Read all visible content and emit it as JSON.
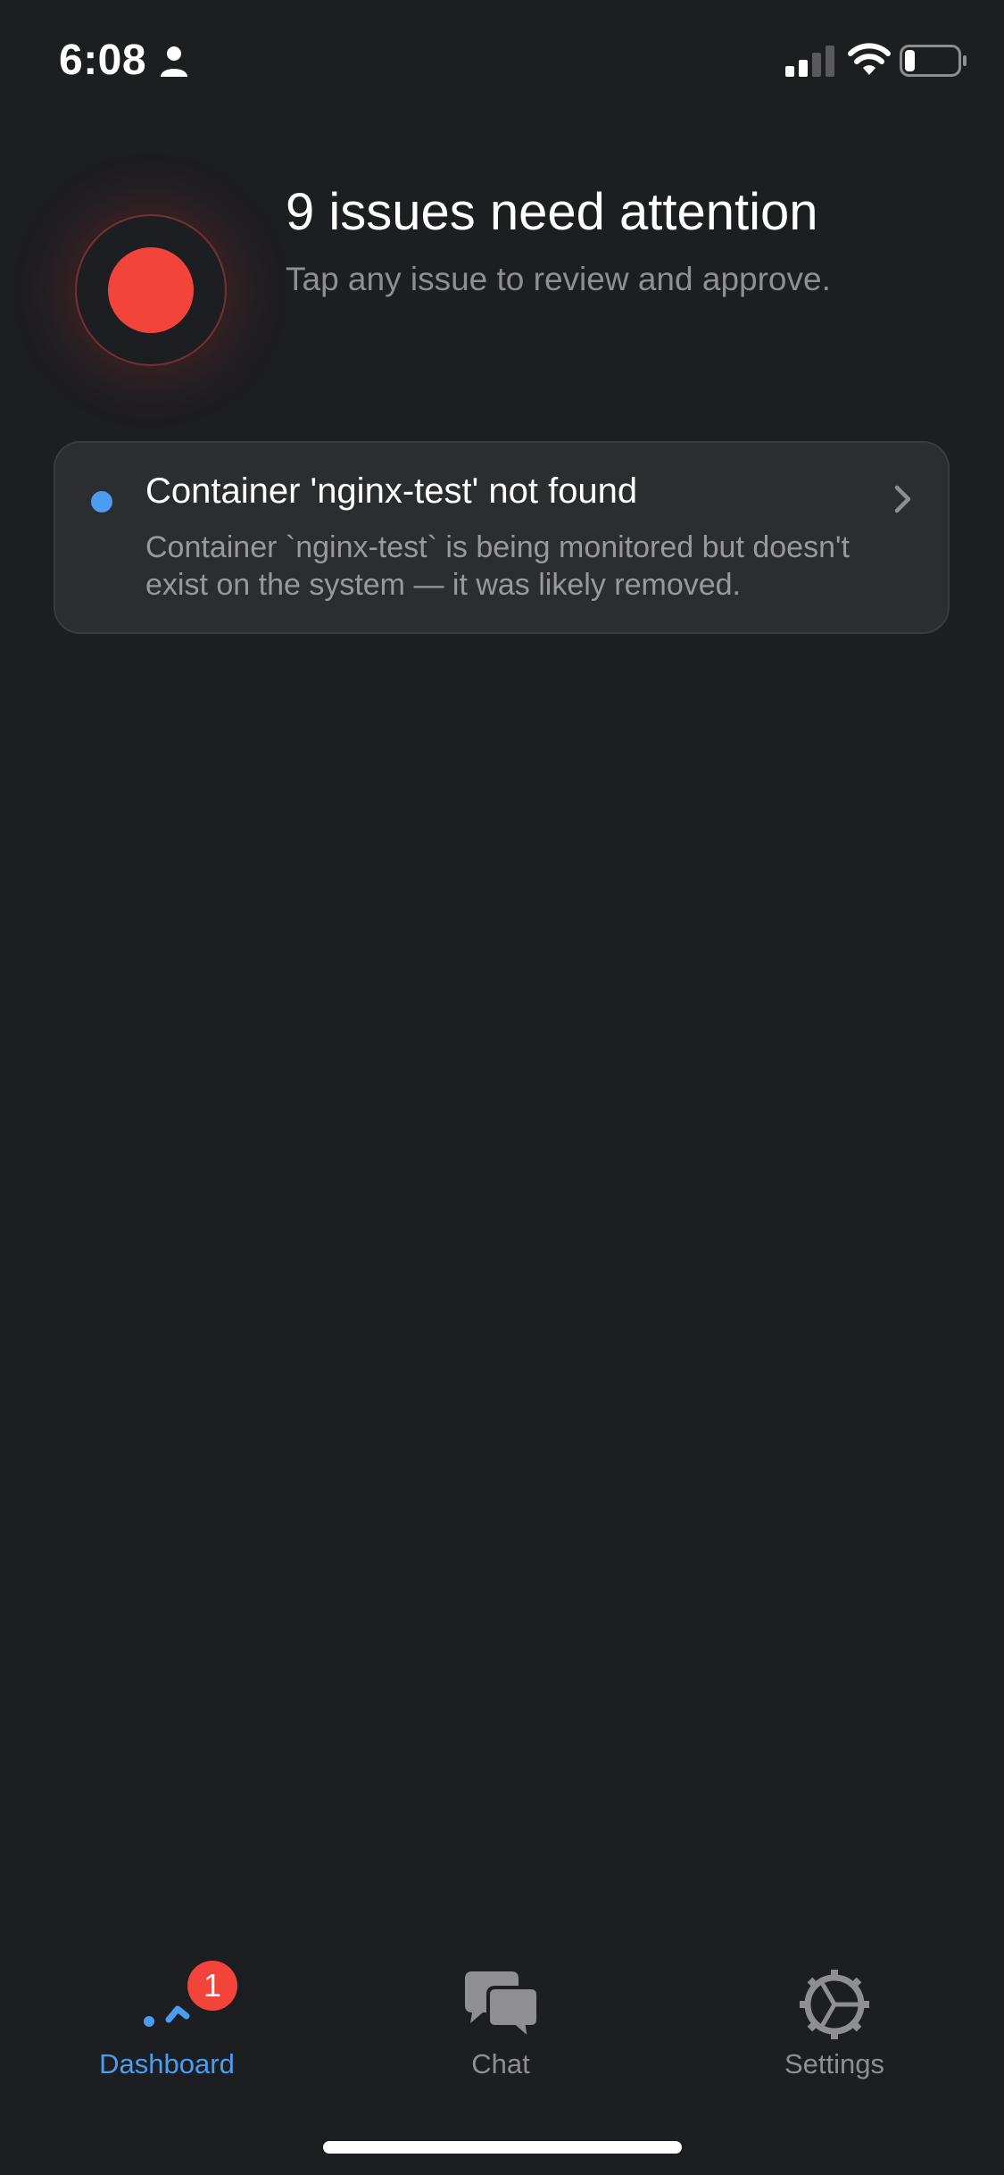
{
  "status_bar": {
    "time": "6:08",
    "icons": [
      "person-icon",
      "signal-icon",
      "wifi-icon",
      "battery-icon"
    ],
    "battery_level": 0.2
  },
  "header": {
    "title": "9 issues need attention",
    "subtitle": "Tap any issue to review and approve.",
    "indicator_color": "#f2443a"
  },
  "issues": [
    {
      "title": "Container 'nginx-test' not found",
      "description": "Container `nginx-test` is being monitored but doesn't exist on the system — it was likely removed.",
      "status_color": "#4a9df0"
    }
  ],
  "tab_bar": {
    "active": "Dashboard",
    "accent_color": "#4a9df0",
    "tabs": [
      {
        "label": "Dashboard",
        "icon": "dashboard-icon",
        "badge": "1"
      },
      {
        "label": "Chat",
        "icon": "chat-bubbles-icon"
      },
      {
        "label": "Settings",
        "icon": "gear-icon"
      }
    ]
  }
}
